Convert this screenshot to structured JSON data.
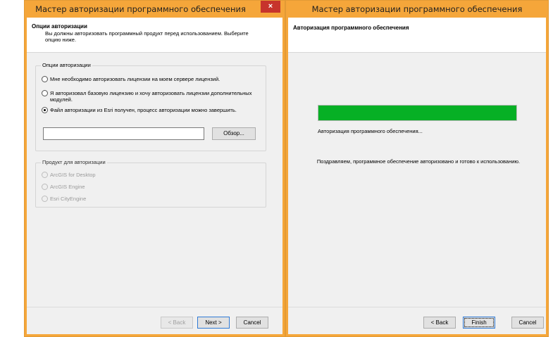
{
  "wizard1": {
    "title": "Мастер авторизации программного обеспечения",
    "close_icon": "×",
    "header_title": "Опции авторизации",
    "header_subtitle": "Вы должны авторизовать программный продукт перед использованием. Выберите опцию ниже.",
    "auth_options": {
      "legend": "Опции авторизации",
      "options": [
        {
          "label": "Мне необходимо авторизовать лицензии на моем сервере лицензий.",
          "checked": false
        },
        {
          "label": "Я авторизовал базовую лицензию и хочу авторизовать лицензии дополнительных модулей.",
          "checked": false
        },
        {
          "label": "Файл авторизации из Esri получен, процесс авторизации можно завершить.",
          "checked": true
        }
      ],
      "file_value": "",
      "browse_label": "Обзор..."
    },
    "product": {
      "legend": "Продукт для авторизации",
      "options": [
        {
          "label": "ArcGIS for Desktop"
        },
        {
          "label": "ArcGIS Engine"
        },
        {
          "label": "Esri CityEngine"
        }
      ]
    },
    "buttons": {
      "back": "< Back",
      "next": "Next >",
      "cancel": "Cancel"
    }
  },
  "wizard2": {
    "title": "Мастер авторизации программного обеспечения",
    "header_title": "Авторизация программного обеспечения",
    "progress": {
      "percent": 100,
      "color": "#06b025"
    },
    "status": "Авторизация программного обеспечения...",
    "message": "Поздравляем, программное обеспечение авторизовано и готово к использованию.",
    "buttons": {
      "back": "< Back",
      "finish": "Finish",
      "cancel": "Cancel"
    }
  },
  "colors": {
    "title_bar": "#f5a63a",
    "close_button": "#c7342c",
    "progress": "#06b025"
  }
}
